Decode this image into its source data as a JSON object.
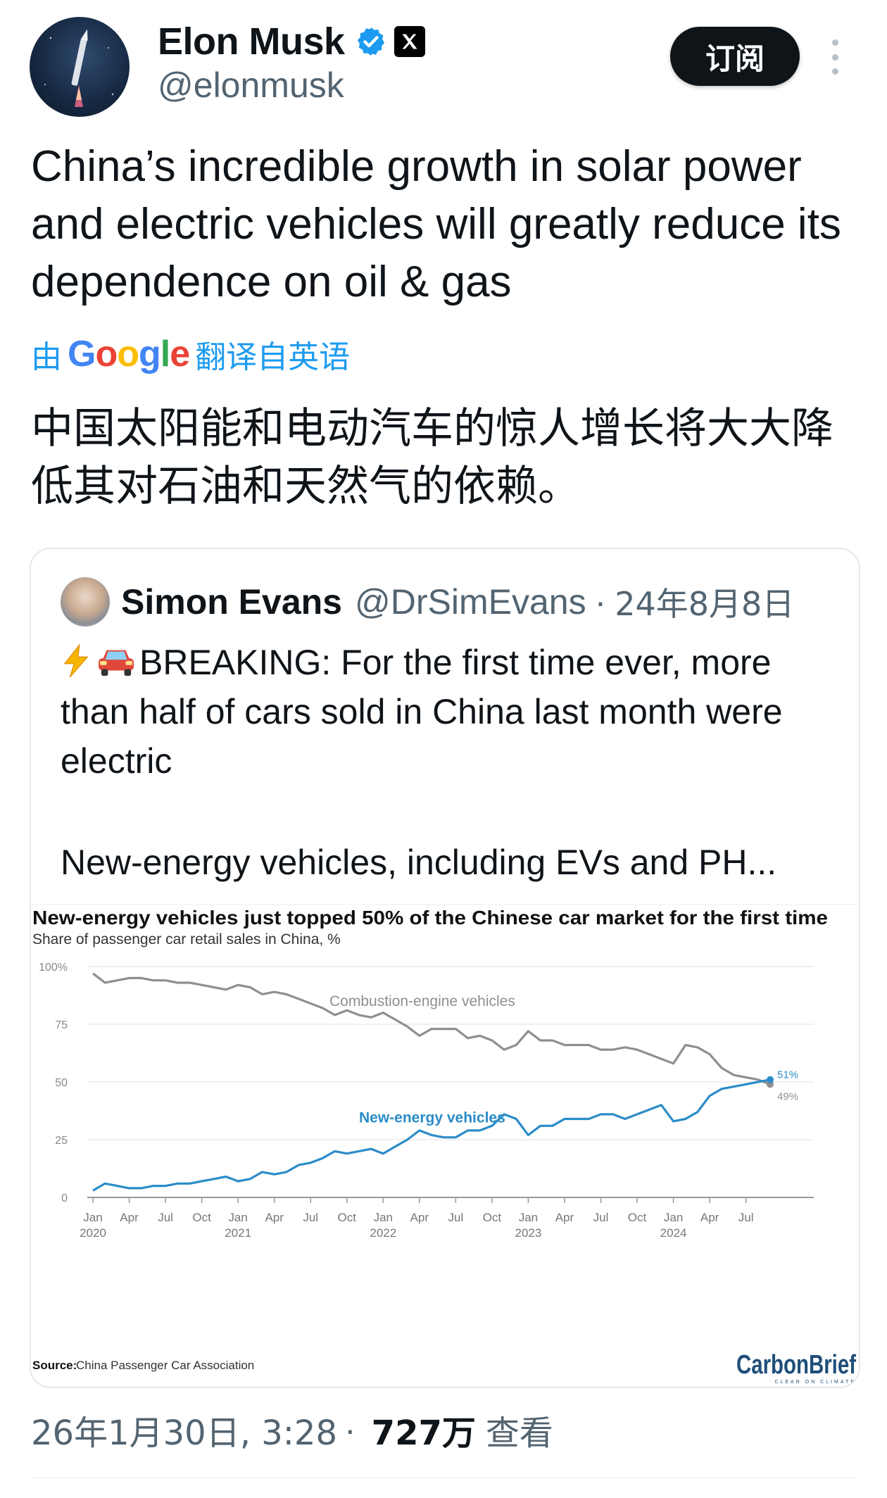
{
  "author": {
    "name": "Elon Musk",
    "handle": "@elonmusk",
    "subscribe_label": "订阅"
  },
  "tweet": {
    "text": "China’s incredible growth in solar power and electric vehicles will greatly reduce its dependence on oil & gas",
    "translate_prefix": "由",
    "translate_brand": "Google",
    "translate_suffix": "翻译自英语",
    "translated_text": "中国太阳能和电动汽车的惊人增长将大大降低其对石油和天然气的依赖。"
  },
  "quoted": {
    "name": "Simon Evans",
    "handle": "@DrSimEvans",
    "separator": "·",
    "date": "24年8月8日",
    "text": "BREAKING: For the first time ever, more than half of cars sold in China last month were electric",
    "text2": "New-energy vehicles, including EVs and PH..."
  },
  "chart_data": {
    "type": "line",
    "title": "New-energy vehicles just topped 50% of the Chinese car market for the first time",
    "subtitle": "Share of passenger car retail sales in China, %",
    "source_label": "Source:",
    "source": "China Passenger Car Association",
    "brand": "CarbonBrief",
    "brand_tagline": "CLEAR ON CLIMATE",
    "ylim": [
      0,
      100
    ],
    "y_ticks": [
      "100%",
      "75",
      "50",
      "25",
      "0"
    ],
    "y_tick_values": [
      100,
      75,
      50,
      25,
      0
    ],
    "x_ticks": [
      {
        "top": "Jan",
        "bottom": "2020"
      },
      {
        "top": "Apr",
        "bottom": ""
      },
      {
        "top": "Jul",
        "bottom": ""
      },
      {
        "top": "Oct",
        "bottom": ""
      },
      {
        "top": "Jan",
        "bottom": "2021"
      },
      {
        "top": "Apr",
        "bottom": ""
      },
      {
        "top": "Jul",
        "bottom": ""
      },
      {
        "top": "Oct",
        "bottom": ""
      },
      {
        "top": "Jan",
        "bottom": "2022"
      },
      {
        "top": "Apr",
        "bottom": ""
      },
      {
        "top": "Jul",
        "bottom": ""
      },
      {
        "top": "Oct",
        "bottom": ""
      },
      {
        "top": "Jan",
        "bottom": "2023"
      },
      {
        "top": "Apr",
        "bottom": ""
      },
      {
        "top": "Jul",
        "bottom": ""
      },
      {
        "top": "Oct",
        "bottom": ""
      },
      {
        "top": "Jan",
        "bottom": "2024"
      },
      {
        "top": "Apr",
        "bottom": ""
      },
      {
        "top": "Jul",
        "bottom": ""
      }
    ],
    "grid": true,
    "series": [
      {
        "name": "Combustion-engine vehicles",
        "color": "#8f8f8f",
        "end_label": "49%",
        "values": [
          97,
          93,
          94,
          95,
          95,
          94,
          94,
          93,
          93,
          92,
          91,
          90,
          92,
          91,
          88,
          89,
          88,
          86,
          84,
          82,
          79,
          81,
          79,
          78,
          80,
          77,
          74,
          70,
          73,
          73,
          73,
          69,
          70,
          68,
          64,
          66,
          72,
          68,
          68,
          66,
          66,
          66,
          64,
          64,
          65,
          64,
          62,
          60,
          58,
          66,
          65,
          62,
          56,
          53,
          52,
          51,
          49
        ]
      },
      {
        "name": "New-energy vehicles",
        "color": "#2b8cc7",
        "end_label": "51%",
        "values": [
          3,
          6,
          5,
          4,
          4,
          5,
          5,
          6,
          6,
          7,
          8,
          9,
          7,
          8,
          11,
          10,
          11,
          14,
          15,
          17,
          20,
          19,
          20,
          21,
          19,
          22,
          25,
          29,
          27,
          26,
          26,
          29,
          29,
          31,
          36,
          34,
          27,
          31,
          31,
          34,
          34,
          34,
          36,
          36,
          34,
          36,
          38,
          40,
          33,
          34,
          37,
          44,
          47,
          48,
          49,
          50,
          51
        ]
      }
    ]
  },
  "footer": {
    "time": "26年1月30日, 3:28",
    "separator": "·",
    "views": "727万",
    "views_label": "查看"
  },
  "colors": {
    "accent": "#1d9bf0",
    "text": "#0f1419",
    "muted": "#536471",
    "nev": "#2b8cc7",
    "ice": "#8f8f8f"
  }
}
